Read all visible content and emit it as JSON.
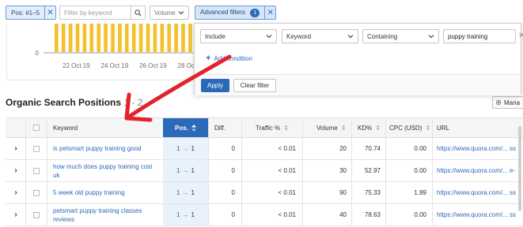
{
  "filter_bar": {
    "pos_chip_label": "Pos: #1–5",
    "search": {
      "placeholder": "Filter by keyword",
      "value": ""
    },
    "volume_label": "Volume",
    "advanced_filters_label": "Advanced filters",
    "advanced_filters_count": "1"
  },
  "chart": {
    "y_tick_label": "0",
    "x_tick_labels": [
      "22 Oct 19",
      "24 Oct 19",
      "26 Oct 19",
      "28 Oct"
    ],
    "bar_color": "#f5c02a"
  },
  "advanced_filter": {
    "include_label": "Include",
    "field_label": "Keyword",
    "operator_label": "Containing",
    "value": "puppy training",
    "add_condition_label": "Add condition",
    "apply_label": "Apply",
    "clear_label": "Clear filter"
  },
  "heading": {
    "title": "Organic Search Positions",
    "range": "1 - 2"
  },
  "manage_label": "Mana",
  "table": {
    "headers": {
      "keyword": "Keyword",
      "pos": "Pos.",
      "diff": "Diff.",
      "traffic": "Traffic %",
      "volume": "Volume",
      "kd": "KD%",
      "cpc": "CPC (USD)",
      "url": "URL"
    },
    "rows": [
      {
        "keyword": "is petsmart puppy training good",
        "pos_from": "1",
        "pos_to": "1",
        "diff": "0",
        "traffic": "< 0.01",
        "volume": "20",
        "kd": "70.74",
        "cpc": "0.00",
        "url": "https://www.quora.com/... ss"
      },
      {
        "keyword": "how much does puppy training cost uk",
        "pos_from": "1",
        "pos_to": "1",
        "diff": "0",
        "traffic": "< 0.01",
        "volume": "30",
        "kd": "52.97",
        "cpc": "0.00",
        "url": "https://www.quora.com/... e-"
      },
      {
        "keyword": "5 week old puppy training",
        "pos_from": "1",
        "pos_to": "1",
        "diff": "0",
        "traffic": "< 0.01",
        "volume": "90",
        "kd": "75.33",
        "cpc": "1.89",
        "url": "https://www.quora.com/... ss"
      },
      {
        "keyword": "petsmart puppy training classes reviews",
        "pos_from": "1",
        "pos_to": "1",
        "diff": "0",
        "traffic": "< 0.01",
        "volume": "40",
        "kd": "78.63",
        "cpc": "0.00",
        "url": "https://www.quora.com/... ss"
      }
    ]
  },
  "colors": {
    "accent": "#2b6ab8",
    "annotation_arrow": "#e3222c",
    "chart_bar": "#f5c02a"
  }
}
